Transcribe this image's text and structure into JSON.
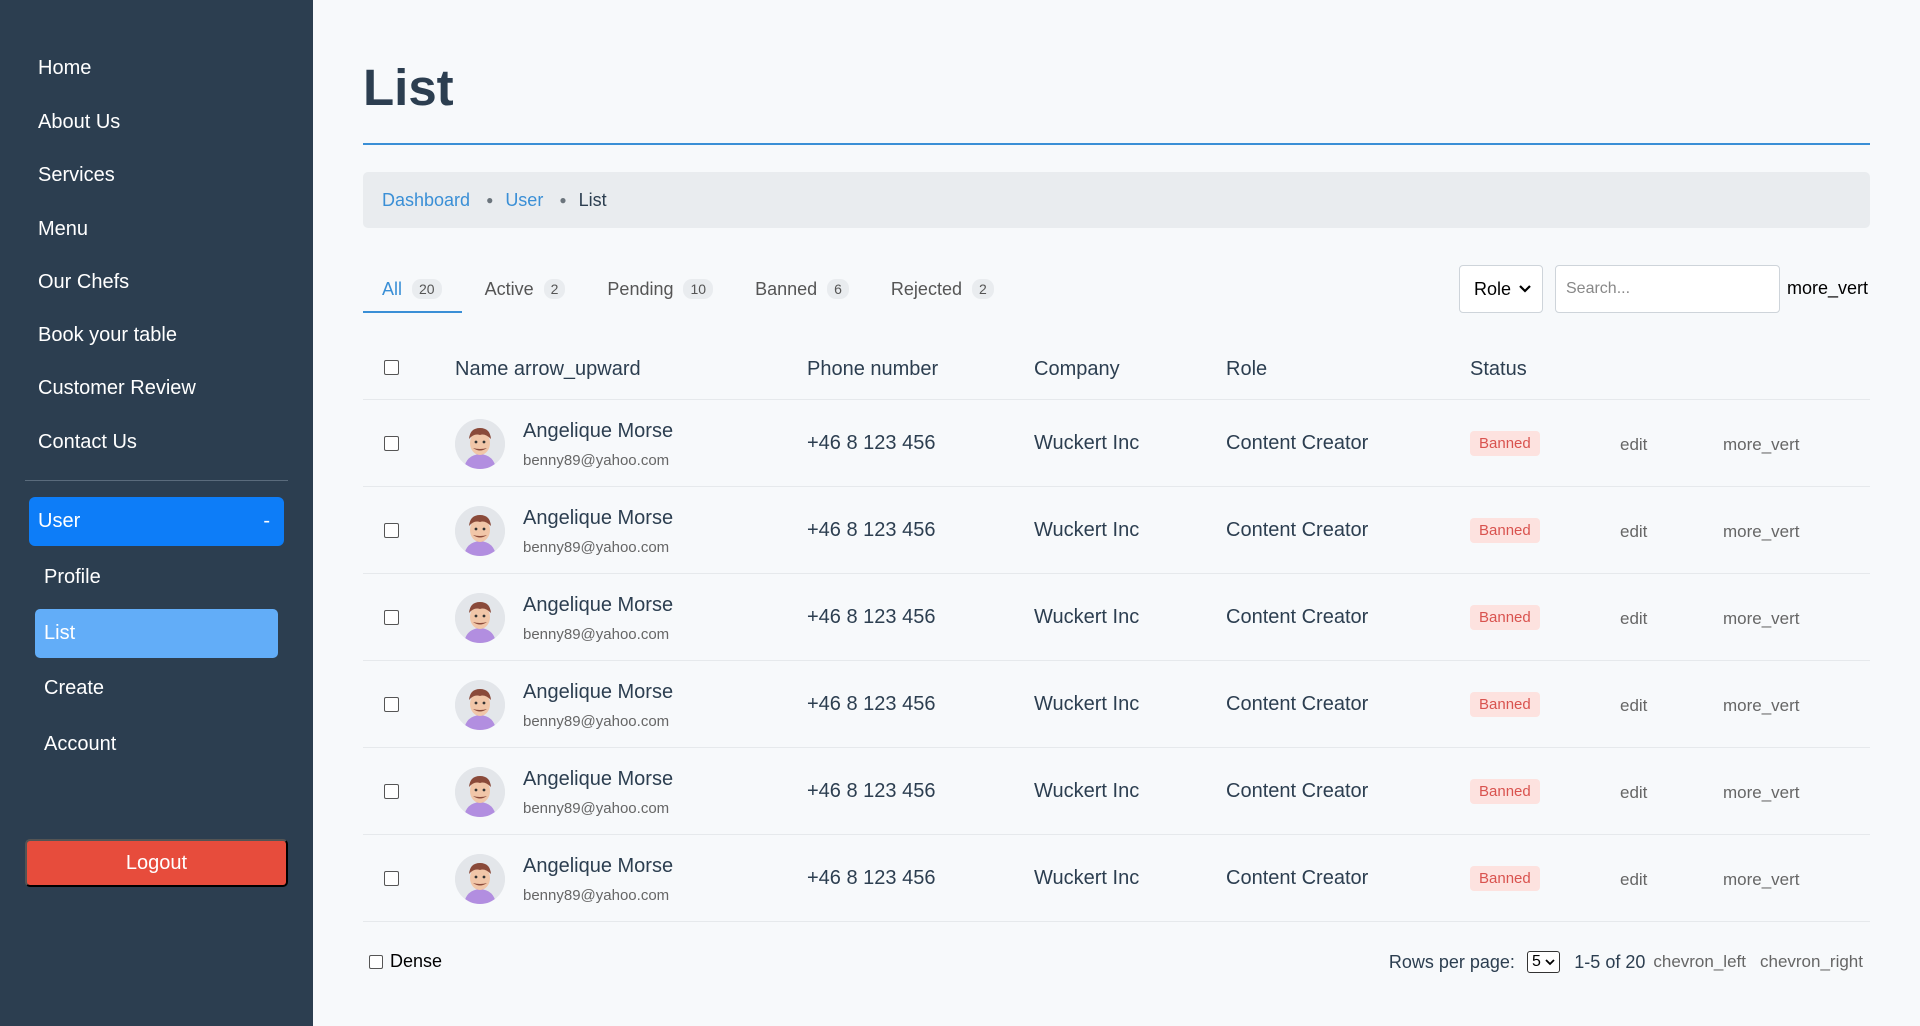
{
  "sidebar": {
    "nav": [
      "Home",
      "About Us",
      "Services",
      "Menu",
      "Our Chefs",
      "Book your table",
      "Customer Review",
      "Contact Us"
    ],
    "user_group": {
      "label": "User",
      "toggle": "-"
    },
    "sub_items": [
      "Profile",
      "List",
      "Create",
      "Account"
    ],
    "active_sub": "List",
    "logout": "Logout"
  },
  "main": {
    "title": "List",
    "breadcrumb": [
      "Dashboard",
      "User",
      "List"
    ],
    "tabs": [
      {
        "label": "All",
        "count": "20"
      },
      {
        "label": "Active",
        "count": "2"
      },
      {
        "label": "Pending",
        "count": "10"
      },
      {
        "label": "Banned",
        "count": "6"
      },
      {
        "label": "Rejected",
        "count": "2"
      }
    ],
    "role_filter": "Role",
    "search_placeholder": "Search...",
    "toolbar_more": "more_vert",
    "table": {
      "headers": {
        "name": "Name arrow_upward",
        "phone": "Phone number",
        "company": "Company",
        "role": "Role",
        "status": "Status"
      },
      "rows": [
        {
          "name": "Angelique Morse",
          "email": "benny89@yahoo.com",
          "phone": "+46 8 123 456",
          "company": "Wuckert Inc",
          "role": "Content Creator",
          "status": "Banned",
          "edit": "edit",
          "more": "more_vert"
        },
        {
          "name": "Angelique Morse",
          "email": "benny89@yahoo.com",
          "phone": "+46 8 123 456",
          "company": "Wuckert Inc",
          "role": "Content Creator",
          "status": "Banned",
          "edit": "edit",
          "more": "more_vert"
        },
        {
          "name": "Angelique Morse",
          "email": "benny89@yahoo.com",
          "phone": "+46 8 123 456",
          "company": "Wuckert Inc",
          "role": "Content Creator",
          "status": "Banned",
          "edit": "edit",
          "more": "more_vert"
        },
        {
          "name": "Angelique Morse",
          "email": "benny89@yahoo.com",
          "phone": "+46 8 123 456",
          "company": "Wuckert Inc",
          "role": "Content Creator",
          "status": "Banned",
          "edit": "edit",
          "more": "more_vert"
        },
        {
          "name": "Angelique Morse",
          "email": "benny89@yahoo.com",
          "phone": "+46 8 123 456",
          "company": "Wuckert Inc",
          "role": "Content Creator",
          "status": "Banned",
          "edit": "edit",
          "more": "more_vert"
        },
        {
          "name": "Angelique Morse",
          "email": "benny89@yahoo.com",
          "phone": "+46 8 123 456",
          "company": "Wuckert Inc",
          "role": "Content Creator",
          "status": "Banned",
          "edit": "edit",
          "more": "more_vert"
        }
      ]
    },
    "footer": {
      "dense_label": "Dense",
      "rows_per_page_label": "Rows per page:",
      "rows_per_page": "5",
      "range": "1-5 of 20",
      "prev": "chevron_left",
      "next": "chevron_right"
    }
  },
  "colors": {
    "sidebar_bg": "#2c3e50",
    "accent": "#3a8fd6",
    "user_group_bg": "#0d7df8",
    "active_sub_bg": "#62adf8",
    "logout_bg": "#e74c3c",
    "banned_badge_bg": "#fde2df",
    "banned_badge_text": "#d9534f"
  }
}
